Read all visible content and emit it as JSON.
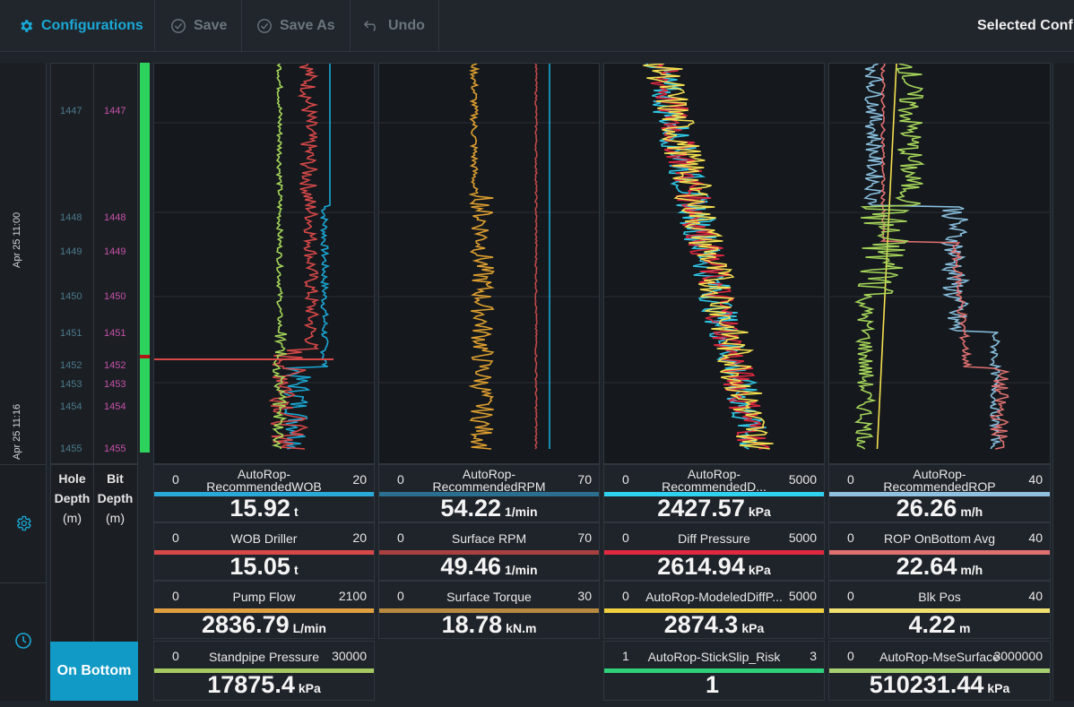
{
  "toolbar": {
    "configurations": "Configurations",
    "save": "Save",
    "save_as": "Save As",
    "undo": "Undo",
    "selected": "Selected Conf"
  },
  "timeline": {
    "label1": "Apr 25 11:00",
    "label2": "Apr 25 11:16"
  },
  "depth_ticks": [
    1447,
    1448,
    1449,
    1450,
    1451,
    1452,
    1453,
    1454,
    1455
  ],
  "depth_headers": {
    "hole": "Hole Depth (m)",
    "hole_line1": "Hole",
    "hole_line2": "Depth",
    "hole_unit": "(m)",
    "bit_line1": "Bit",
    "bit_line2": "Depth",
    "bit_unit": "(m)"
  },
  "status_button": "On Bottom",
  "colors": {
    "blue": "#1aa8d6",
    "red": "#d84848",
    "green": "#a6d65a",
    "orange": "#e0a030",
    "cyan": "#30c8e8",
    "yellow": "#f5e050",
    "lightblue": "#8ac0e0",
    "salmon": "#e06060",
    "status_green": "#2ed35e"
  },
  "tracks": [
    {
      "cells": [
        {
          "name": "AutoRop-RecommendedWOB",
          "min": "0",
          "max": "20",
          "value": "15.92",
          "unit": "t",
          "color": "#2aa8d8"
        },
        {
          "name": "WOB Driller",
          "min": "0",
          "max": "20",
          "value": "15.05",
          "unit": "t",
          "color": "#d84848"
        },
        {
          "name": "Pump Flow",
          "min": "0",
          "max": "2100",
          "value": "2836.79",
          "unit": "L/min",
          "color": "#e0a040"
        },
        {
          "name": "Standpipe Pressure",
          "min": "0",
          "max": "30000",
          "value": "17875.4",
          "unit": "kPa",
          "color": "#a6c860"
        }
      ]
    },
    {
      "cells": [
        {
          "name": "AutoRop-RecommendedRPM",
          "min": "0",
          "max": "70",
          "value": "54.22",
          "unit": "1/min",
          "color": "#2a6f8f"
        },
        {
          "name": "Surface RPM",
          "min": "0",
          "max": "70",
          "value": "49.46",
          "unit": "1/min",
          "color": "#a84040"
        },
        {
          "name": "Surface Torque",
          "min": "0",
          "max": "30",
          "value": "18.78",
          "unit": "kN.m",
          "color": "#b88a40"
        }
      ]
    },
    {
      "cells": [
        {
          "name": "AutoRop-RecommendedD...",
          "min": "0",
          "max": "5000",
          "value": "2427.57",
          "unit": "kPa",
          "color": "#30d0f0"
        },
        {
          "name": "Diff Pressure",
          "min": "0",
          "max": "5000",
          "value": "2614.94",
          "unit": "kPa",
          "color": "#e02840"
        },
        {
          "name": "AutoRop-ModeledDiffP...",
          "min": "0",
          "max": "5000",
          "value": "2874.3",
          "unit": "kPa",
          "color": "#f0d040"
        },
        {
          "name": "AutoRop-StickSlip_Risk",
          "min": "1",
          "max": "3",
          "value": "1",
          "unit": "",
          "color": "#2ed07a"
        }
      ]
    },
    {
      "cells": [
        {
          "name": "AutoRop-RecommendedROP",
          "min": "0",
          "max": "40",
          "value": "26.26",
          "unit": "m/h",
          "color": "#90c0e0"
        },
        {
          "name": "ROP OnBottom Avg",
          "min": "0",
          "max": "40",
          "value": "22.64",
          "unit": "m/h",
          "color": "#e07070"
        },
        {
          "name": "Blk Pos",
          "min": "0",
          "max": "40",
          "value": "4.22",
          "unit": "m",
          "color": "#f0e070"
        },
        {
          "name": "AutoRop-MseSurface",
          "min": "0",
          "max": "3000000",
          "value": "510231.44",
          "unit": "kPa",
          "color": "#a6d070"
        }
      ]
    }
  ]
}
